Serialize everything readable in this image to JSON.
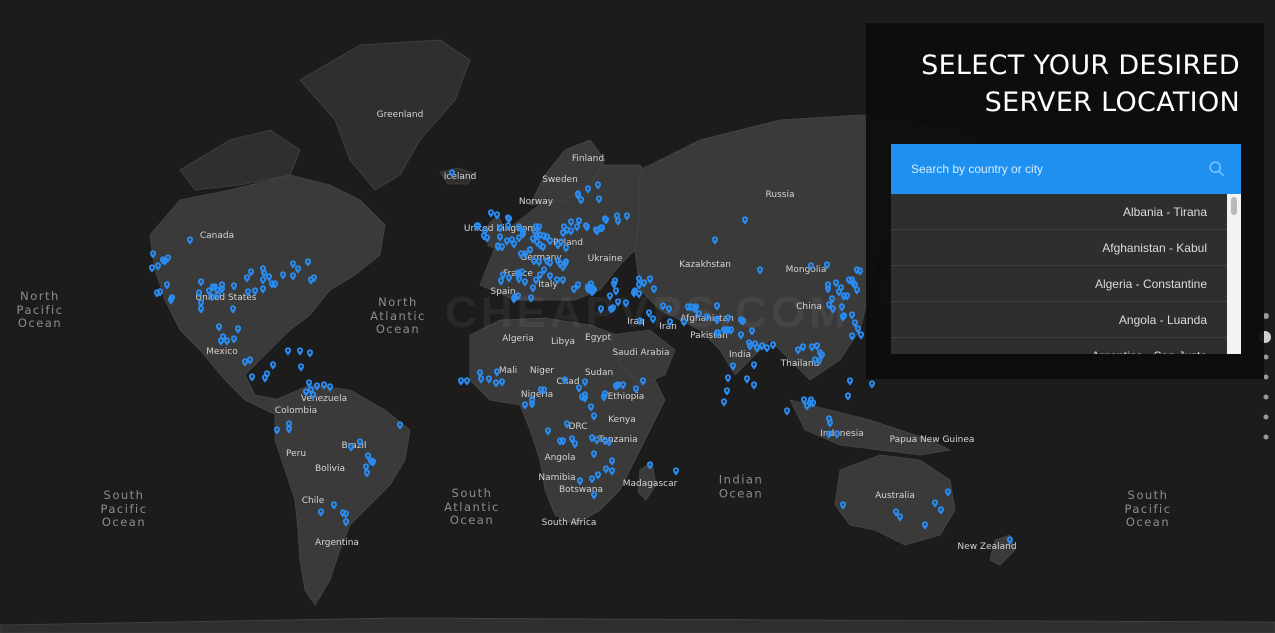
{
  "panel": {
    "title_line1": "SELECT YOUR DESIRED",
    "title_line2": "SERVER LOCATION",
    "search": {
      "placeholder": "Search by country or city",
      "value": ""
    },
    "locations": [
      "Albania - Tirana",
      "Afghanistan - Kabul",
      "Algeria - Constantine",
      "Angola - Luanda",
      "Argentina - San Justo"
    ]
  },
  "map": {
    "watermark": "CHEAPVPS.COM",
    "oceans": [
      {
        "id": "north-pacific",
        "text": "North\nPacific\nOcean"
      },
      {
        "id": "north-atlantic",
        "text": "North\nAtlantic\nOcean"
      },
      {
        "id": "south-pacific-west",
        "text": "South\nPacific\nOcean"
      },
      {
        "id": "south-atlantic",
        "text": "South\nAtlantic\nOcean"
      },
      {
        "id": "indian",
        "text": "Indian\nOcean"
      },
      {
        "id": "south-pacific-east",
        "text": "South\nPacific\nOcean"
      }
    ],
    "labels": [
      "Greenland",
      "Iceland",
      "Finland",
      "Sweden",
      "Norway",
      "Russia",
      "United Kingdom",
      "Poland",
      "Germany",
      "Ukraine",
      "France",
      "Italy",
      "Spain",
      "Kazakhstan",
      "Mongolia",
      "Canada",
      "United States",
      "Mexico",
      "Algeria",
      "Libya",
      "Egypt",
      "Iraq",
      "Iran",
      "Afghanistan",
      "Pakistan",
      "India",
      "China",
      "Saudi Arabia",
      "Mali",
      "Niger",
      "Chad",
      "Sudan",
      "Nigeria",
      "Ethiopia",
      "DRC",
      "Kenya",
      "Tanzania",
      "Angola",
      "Namibia",
      "Botswana",
      "South Africa",
      "Madagascar",
      "Thailand",
      "Indonesia",
      "Papua New Guinea",
      "Australia",
      "New Zealand",
      "Venezuela",
      "Colombia",
      "Brazil",
      "Peru",
      "Bolivia",
      "Chile",
      "Argentina"
    ]
  },
  "colors": {
    "accent": "#1e90f0",
    "pin": "#2a8cf0",
    "panel_bg": "#0c0c0c",
    "list_bg": "#2e2e2e",
    "map_land": "#3a3a3a",
    "map_water": "#1c1c1c"
  }
}
